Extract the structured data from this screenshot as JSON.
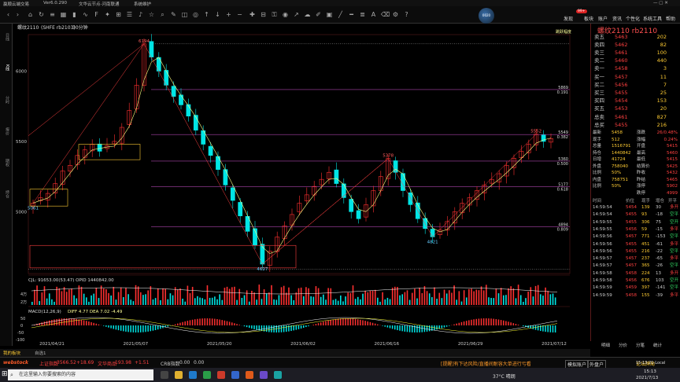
{
  "titlebar": {
    "app_name": "赢顺云端交易",
    "version": "Ver6.0.290",
    "server": "文华云节点-河南联通",
    "status": "系统维护"
  },
  "menus": [
    "发现",
    "板块",
    "账户",
    "资讯",
    "个性化",
    "系统工具",
    "帮助"
  ],
  "menu_badge": "99+",
  "avatar_label": "0020",
  "sidetabs": [
    "日线",
    "K线",
    "分时",
    "报价",
    "期权",
    "持仓"
  ],
  "chart_header": {
    "symbol": "螺纹2110",
    "detail": "(SHFE rb2103)",
    "period": "30分钟"
  },
  "chart_colors": {
    "bg": "#000000",
    "up": "#ff3030",
    "down": "#00e5e5",
    "avg": "#ffff80",
    "ma": "#ff66ff",
    "grid_line": "#aa44aa"
  },
  "price_axis": [
    {
      "price": 6000,
      "label": "6000"
    },
    {
      "price": 5500,
      "label": "5500"
    },
    {
      "price": 5000,
      "label": "5000"
    }
  ],
  "fib_levels": [
    {
      "price": 5869,
      "label": "5869",
      "ratio": "0.191"
    },
    {
      "price": 5549,
      "label": "5549",
      "ratio": "0.382"
    },
    {
      "price": 5360,
      "label": "5360",
      "ratio": "0.500"
    },
    {
      "price": 5177,
      "label": "5177",
      "ratio": "0.618"
    },
    {
      "price": 4894,
      "label": "4894",
      "ratio": "0.809"
    }
  ],
  "annotations": {
    "high": "6194",
    "low": "4627",
    "left_low": "5061",
    "mid_high": "5378",
    "mid_low": "4821",
    "right_high": "5552",
    "top_right": "跳跃幅度"
  },
  "chart_data": {
    "type": "line",
    "ylim": [
      4560,
      6260
    ],
    "x_ticks": [
      "2021/04/21",
      "2021/05/07",
      "2021/05/20",
      "2021/06/02",
      "2021/06/16",
      "2021/06/29",
      "2021/07/12"
    ],
    "series": [
      {
        "values": [
          5061,
          5100,
          5130,
          5200,
          5290,
          5330,
          5400,
          5440,
          5480,
          5430,
          5470,
          5500,
          5600,
          5720,
          5900,
          6194,
          6100,
          6000,
          5900,
          5820,
          5760,
          5680,
          5580,
          5480,
          5400,
          5300,
          5190,
          5080,
          4970,
          4860,
          4760,
          4627,
          4720,
          4820,
          4900,
          4980,
          5060,
          5120,
          5180,
          5230,
          5280,
          5200,
          5100,
          5000,
          4950,
          5050,
          5150,
          5250,
          5378,
          5280,
          5150,
          5050,
          4950,
          4880,
          4821,
          4870,
          4930,
          5000,
          5060,
          5100,
          5150,
          5190,
          5230,
          5270,
          5330,
          5380,
          5430,
          5480,
          5552,
          5500,
          5520
        ]
      }
    ]
  },
  "volume_label": "CJL: 91653.00(53.47) OPID 1440842.00",
  "volume_axis": [
    "4万",
    "2万"
  ],
  "macd_label": "MACD(12,26,9)",
  "macd_values": "DIFF 4.77  DEA 7.02  -4.49",
  "macd_axis": [
    "50",
    "0",
    "-50",
    "-100"
  ],
  "quote": {
    "title": "螺纹2110",
    "code": "rb2110",
    "asks": [
      {
        "label": "卖五",
        "price": "5463",
        "vol": "202"
      },
      {
        "label": "卖四",
        "price": "5462",
        "vol": "82"
      },
      {
        "label": "卖三",
        "price": "5461",
        "vol": "100"
      },
      {
        "label": "卖二",
        "price": "5460",
        "vol": "440"
      },
      {
        "label": "卖一",
        "price": "5458",
        "vol": "3"
      }
    ],
    "bids": [
      {
        "label": "买一",
        "price": "5457",
        "vol": "11"
      },
      {
        "label": "买二",
        "price": "5456",
        "vol": "7"
      },
      {
        "label": "买三",
        "price": "5455",
        "vol": "25"
      },
      {
        "label": "买四",
        "price": "5454",
        "vol": "153"
      },
      {
        "label": "买五",
        "price": "5453",
        "vol": "20"
      }
    ],
    "totals": [
      {
        "label": "总卖",
        "price": "5461",
        "vol": "827"
      },
      {
        "label": "总买",
        "price": "5455",
        "vol": "216"
      }
    ],
    "stats": [
      {
        "l1": "最新",
        "v1": "5458",
        "l2": "涨跌",
        "v2": "26/0.48%"
      },
      {
        "l1": "现手",
        "v1": "512",
        "l2": "涨幅",
        "v2": "0.24%"
      },
      {
        "l1": "总量",
        "v1": "1516791",
        "l2": "开盘",
        "v2": "5415"
      },
      {
        "l1": "持仓",
        "v1": "1440842",
        "l2": "最高",
        "v2": "5460"
      },
      {
        "l1": "日增",
        "v1": "41724",
        "l2": "最低",
        "v2": "5415"
      },
      {
        "l1": "外盘",
        "v1": "758040",
        "l2": "结算价",
        "v2": "5425"
      },
      {
        "l1": "比例",
        "v1": "50%",
        "l2": "昨收",
        "v2": "5432"
      },
      {
        "l1": "内盘",
        "v1": "758751",
        "l2": "昨结",
        "v2": "5465"
      },
      {
        "l1": "比例",
        "v1": "50%",
        "l2": "涨停",
        "v2": "5902"
      },
      {
        "l1": "",
        "v1": "",
        "l2": "跌停",
        "v2": "4999"
      }
    ],
    "tick_headers": [
      "时间",
      "价位",
      "现手",
      "增仓",
      "开平"
    ],
    "ticks": [
      {
        "t": "14:59:54",
        "p": "5454",
        "v": "139",
        "d": "30",
        "k": "多开"
      },
      {
        "t": "14:59:54",
        "p": "5455",
        "v": "93",
        "d": "-18",
        "k": "空平"
      },
      {
        "t": "14:59:55",
        "p": "5455",
        "v": "306",
        "d": "75",
        "k": "空开"
      },
      {
        "t": "14:59:55",
        "p": "5456",
        "v": "59",
        "d": "-15",
        "k": "多平"
      },
      {
        "t": "14:59:56",
        "p": "5457",
        "v": "771",
        "d": "-153",
        "k": "空平"
      },
      {
        "t": "14:59:56",
        "p": "5455",
        "v": "451",
        "d": "-61",
        "k": "多平"
      },
      {
        "t": "14:59:56",
        "p": "5455",
        "v": "216",
        "d": "-22",
        "k": "空平"
      },
      {
        "t": "14:59:57",
        "p": "5457",
        "v": "237",
        "d": "-65",
        "k": "多平"
      },
      {
        "t": "14:59:57",
        "p": "5457",
        "v": "365",
        "d": "-26",
        "k": "空平"
      },
      {
        "t": "14:59:58",
        "p": "5458",
        "v": "224",
        "d": "13",
        "k": "多开"
      },
      {
        "t": "14:59:58",
        "p": "5456",
        "v": "676",
        "d": "103",
        "k": "空开"
      },
      {
        "t": "14:59:59",
        "p": "5459",
        "v": "397",
        "d": "-141",
        "k": "空平"
      },
      {
        "t": "14:59:59",
        "p": "5458",
        "v": "155",
        "d": "-39",
        "k": "多平"
      }
    ],
    "bottom_tabs": [
      "明细",
      "分价",
      "分笔",
      "统计"
    ]
  },
  "bottom_tabstrip": [
    "我的板块",
    "自选1"
  ],
  "statusbar": {
    "idx1_name": "上证指数",
    "idx1_val": "3566.52",
    "idx1_chg": "+18.69",
    "idx2_name": "文华商品",
    "idx2_val": "193.98",
    "idx2_chg": "+1.51",
    "idx3_name": "CRB指数",
    "idx3_val": "0.00",
    "idx3_chg": "0.00",
    "notice": "[提醒]有下达风险/直播间耐容大单进行亏看",
    "btn1": "模拟账户",
    "btn2": "外盘户",
    "time": "15:13:21-Local",
    "brand": "webstock",
    "right_brand": "论坛牌局"
  },
  "taskbar": {
    "search_placeholder": "在这里输入你要搜索的内容",
    "weather": "37°C 晴朗",
    "clock_time": "15:13",
    "clock_date": "2021/7/13"
  }
}
